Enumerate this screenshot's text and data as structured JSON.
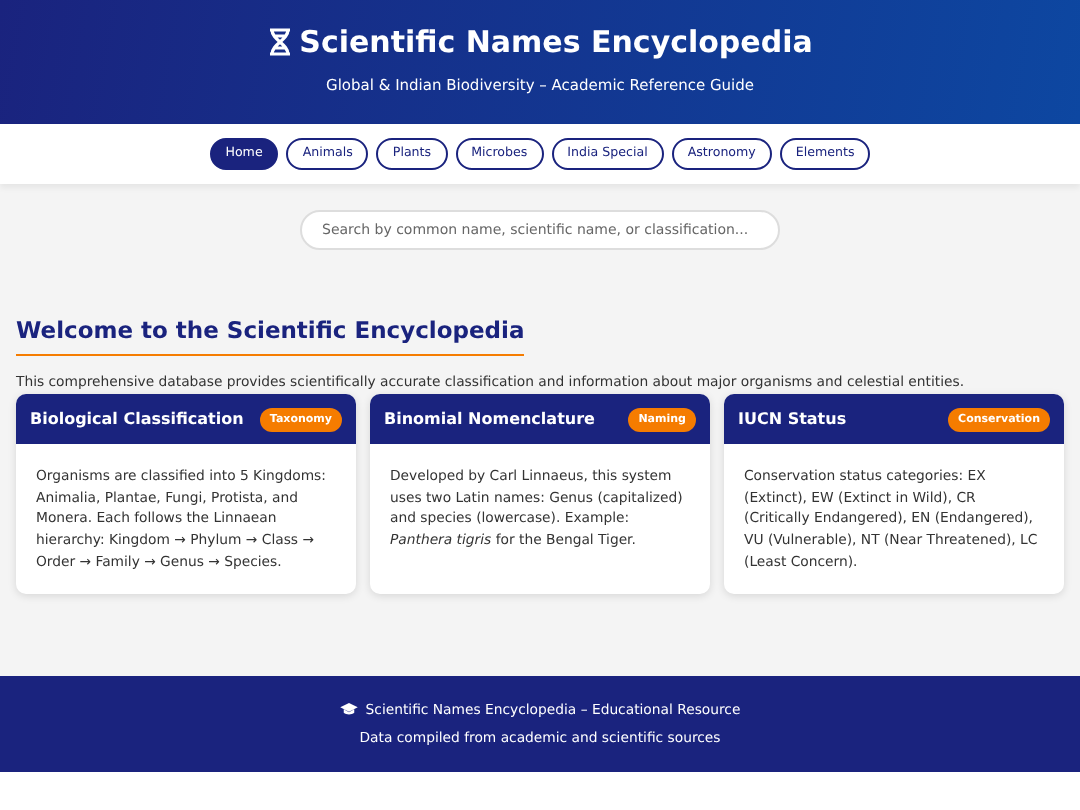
{
  "header": {
    "title": "Scientific Names Encyclopedia",
    "subtitle": "Global & Indian Biodiversity – Academic Reference Guide"
  },
  "nav": [
    {
      "label": "Home",
      "selected": true
    },
    {
      "label": "Animals",
      "selected": false
    },
    {
      "label": "Plants",
      "selected": false
    },
    {
      "label": "Microbes",
      "selected": false
    },
    {
      "label": "India Special",
      "selected": false
    },
    {
      "label": "Astronomy",
      "selected": false
    },
    {
      "label": "Elements",
      "selected": false
    }
  ],
  "search": {
    "placeholder": "Search by common name, scientific name, or classification..."
  },
  "welcome": {
    "heading": "Welcome to the Scientific Encyclopedia",
    "intro": "This comprehensive database provides scientifically accurate classification and information about major organisms and celestial entities."
  },
  "cards": [
    {
      "title": "Biological Classification",
      "badge": "Taxonomy",
      "text": "Organisms are classified into 5 Kingdoms: Animalia, Plantae, Fungi, Protista, and Monera. Each follows the Linnaean hierarchy: Kingdom → Phylum → Class → Order → Family → Genus → Species."
    },
    {
      "title": "Binomial Nomenclature",
      "badge": "Naming",
      "text": "Developed by Carl Linnaeus, this system uses two Latin names: Genus (capitalized) and species (lowercase). Example: *Panthera tigris* for the Bengal Tiger."
    },
    {
      "title": "IUCN Status",
      "badge": "Conservation",
      "text": "Conservation status categories: EX (Extinct), EW (Extinct in Wild), CR (Critically Endangered), EN (Endangered), VU (Vulnerable), NT (Near Threatened), LC (Least Concern)."
    }
  ],
  "footer": {
    "line1": "Scientific Names Encyclopedia – Educational Resource",
    "line2": "Data compiled from academic and scientific sources"
  }
}
